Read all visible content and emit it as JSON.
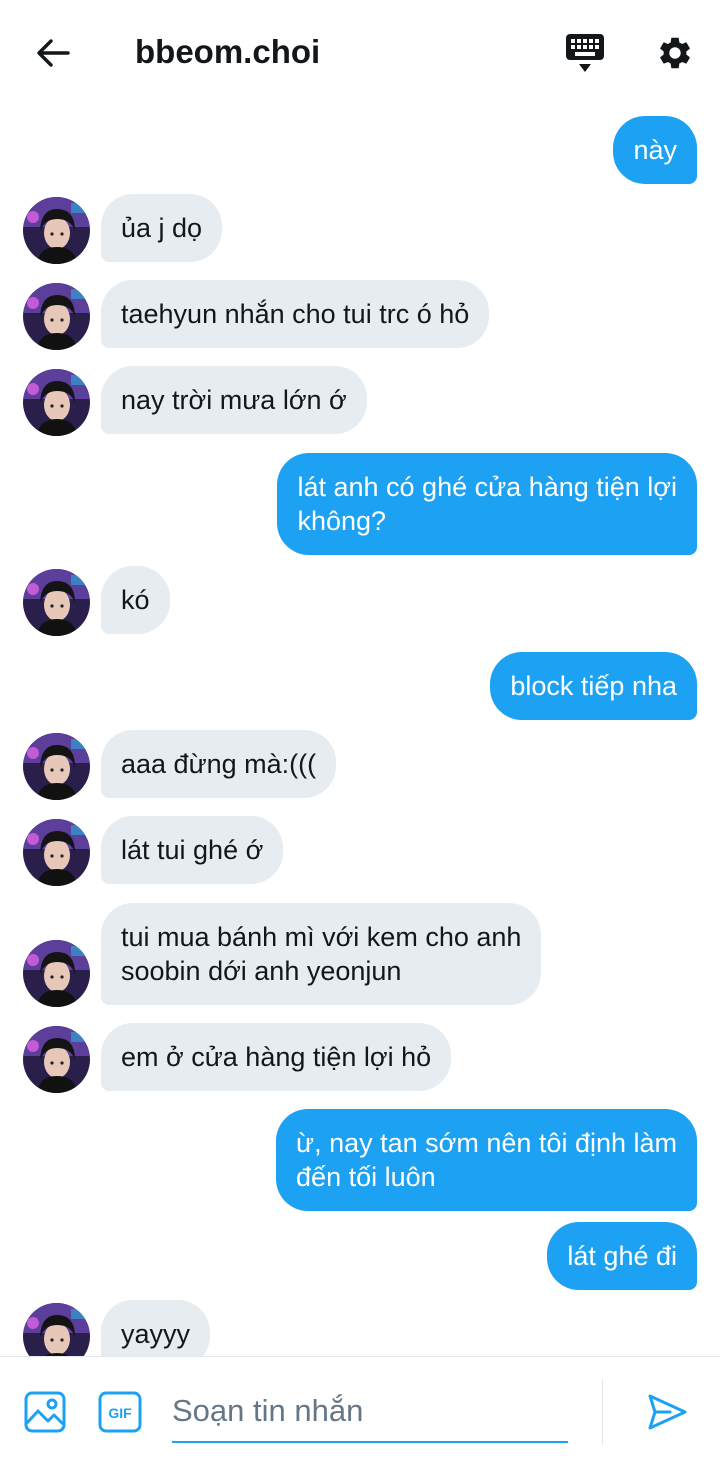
{
  "header": {
    "title": "bbeom.choi",
    "back_icon": "arrow-left-icon",
    "keyboard_icon": "keyboard-icon",
    "settings_icon": "gear-icon"
  },
  "colors": {
    "accent": "#1da1f2",
    "incoming_bubble": "#e6ecf0",
    "text": "#14171a"
  },
  "messages": [
    {
      "dir": "out",
      "text": "này"
    },
    {
      "dir": "in",
      "text": "ủa j dọ"
    },
    {
      "dir": "in",
      "text": "taehyun nhắn cho tui trc ó hỏ"
    },
    {
      "dir": "in",
      "text": "nay trời mưa lớn ớ"
    },
    {
      "dir": "out",
      "text": "lát anh có ghé cửa hàng tiện lợi\nkhông?"
    },
    {
      "dir": "in",
      "text": "kó"
    },
    {
      "dir": "out",
      "text": "block tiếp nha"
    },
    {
      "dir": "in",
      "text": "aaa đừng mà:((("
    },
    {
      "dir": "in",
      "text": "lát tui ghé ớ"
    },
    {
      "dir": "in",
      "text": "tui mua bánh mì với kem cho anh\nsoobin dới anh yeonjun"
    },
    {
      "dir": "in",
      "text": "em ở cửa hàng tiện lợi hỏ"
    },
    {
      "dir": "out",
      "text": "ừ, nay tan sớm nên tôi định làm\nđến tối luôn"
    },
    {
      "dir": "out",
      "text": "lát ghé đi"
    },
    {
      "dir": "in",
      "text": "yayyy"
    }
  ],
  "composer": {
    "placeholder": "Soạn tin nhắn",
    "image_icon": "image-icon",
    "gif_icon": "gif-icon",
    "gif_label": "GIF",
    "send_icon": "send-icon"
  }
}
